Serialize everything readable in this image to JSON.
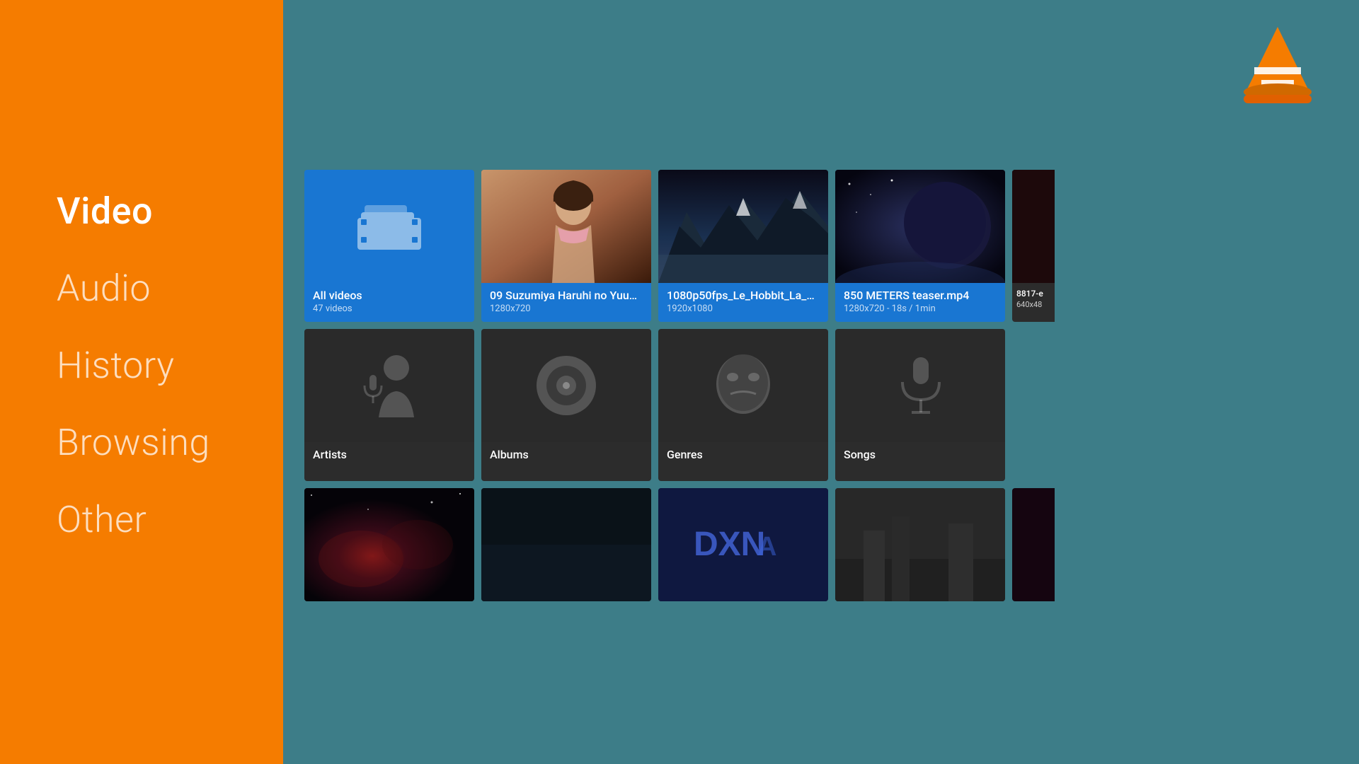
{
  "sidebar": {
    "items": [
      {
        "id": "video",
        "label": "Video",
        "active": true
      },
      {
        "id": "audio",
        "label": "Audio",
        "active": false
      },
      {
        "id": "history",
        "label": "History",
        "active": false
      },
      {
        "id": "browsing",
        "label": "Browsing",
        "active": false
      },
      {
        "id": "other",
        "label": "Other",
        "active": false
      }
    ]
  },
  "grid": {
    "row1": [
      {
        "id": "all-videos",
        "title": "All videos",
        "subtitle": "47 videos",
        "type": "folder",
        "selected": true
      },
      {
        "id": "suzumiya",
        "title": "09 Suzumiya Haruhi no Yuuut...",
        "subtitle": "1280x720",
        "type": "video-anime"
      },
      {
        "id": "hobbit",
        "title": "1080p50fps_Le_Hobbit_La_d...",
        "subtitle": "1920x1080",
        "type": "video-hobbit"
      },
      {
        "id": "850m",
        "title": "850 METERS teaser.mp4",
        "subtitle": "1280x720 - 18s / 1min",
        "type": "video-850m"
      },
      {
        "id": "8817",
        "title": "8817-e",
        "subtitle": "640x48",
        "type": "video-partial"
      }
    ],
    "row2": [
      {
        "id": "artists",
        "title": "Artists",
        "subtitle": "",
        "type": "artist"
      },
      {
        "id": "albums",
        "title": "Albums",
        "subtitle": "",
        "type": "album"
      },
      {
        "id": "genres",
        "title": "Genres",
        "subtitle": "",
        "type": "genre"
      },
      {
        "id": "songs",
        "title": "Songs",
        "subtitle": "",
        "type": "song"
      }
    ],
    "row3": [
      {
        "id": "vid-space",
        "type": "video-space"
      },
      {
        "id": "vid-dark",
        "type": "video-dark"
      },
      {
        "id": "vid-blue",
        "type": "video-blue-text"
      },
      {
        "id": "vid-gray",
        "type": "video-gray"
      },
      {
        "id": "vid-partial2",
        "type": "video-partial2"
      }
    ]
  },
  "vlc": {
    "logo_alt": "VLC Media Player"
  }
}
